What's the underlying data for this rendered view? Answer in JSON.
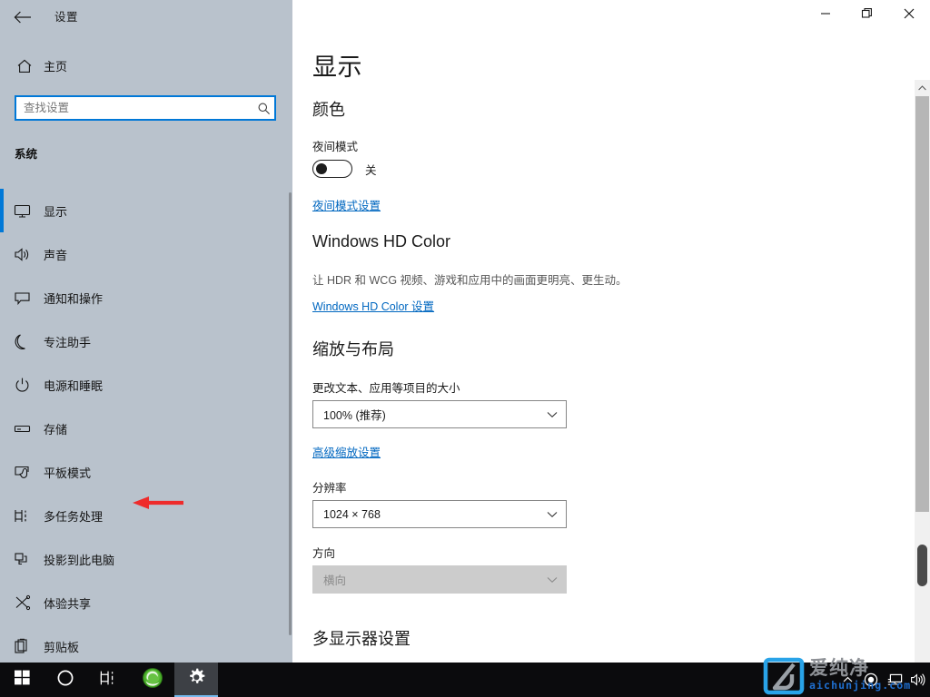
{
  "window": {
    "app_title": "设置",
    "back_icon": "back-arrow-icon",
    "minimize_label": "—",
    "maximize_label": "❐",
    "close_label": "✕"
  },
  "sidebar": {
    "home": {
      "label": "主页",
      "icon": "home-icon"
    },
    "search": {
      "placeholder": "查找设置",
      "value": "",
      "icon": "search-icon"
    },
    "group_title": "系统",
    "items": [
      {
        "label": "显示",
        "icon": "monitor-icon",
        "active": true
      },
      {
        "label": "声音",
        "icon": "speaker-icon",
        "active": false
      },
      {
        "label": "通知和操作",
        "icon": "notification-icon",
        "active": false
      },
      {
        "label": "专注助手",
        "icon": "moon-icon",
        "active": false
      },
      {
        "label": "电源和睡眠",
        "icon": "power-icon",
        "active": false
      },
      {
        "label": "存储",
        "icon": "storage-icon",
        "active": false
      },
      {
        "label": "平板模式",
        "icon": "tablet-mode-icon",
        "active": false
      },
      {
        "label": "多任务处理",
        "icon": "multitasking-icon",
        "active": false
      },
      {
        "label": "投影到此电脑",
        "icon": "project-to-pc-icon",
        "active": false
      },
      {
        "label": "体验共享",
        "icon": "shared-experiences-icon",
        "active": false
      },
      {
        "label": "剪贴板",
        "icon": "clipboard-icon",
        "active": false
      }
    ]
  },
  "main": {
    "page_title": "显示",
    "color_section": {
      "heading": "颜色",
      "night_light_label": "夜间模式",
      "night_light_state": "关",
      "night_light_on": false,
      "night_light_settings_link": "夜间模式设置"
    },
    "hdr_section": {
      "heading": "Windows HD Color",
      "description": "让 HDR 和 WCG 视频、游戏和应用中的画面更明亮、更生动。",
      "link": "Windows HD Color 设置"
    },
    "scale_section": {
      "heading": "缩放与布局",
      "scale_label": "更改文本、应用等项目的大小",
      "scale_value": "100% (推荐)",
      "advanced_link": "高级缩放设置",
      "resolution_label": "分辨率",
      "resolution_value": "1024 × 768",
      "orientation_label": "方向",
      "orientation_value": "横向",
      "orientation_disabled": true
    },
    "multi_display_heading": "多显示器设置"
  },
  "annotation": {
    "arrow": "red-left-arrow",
    "color": "#ee2b2b"
  },
  "taskbar": {
    "items": [
      {
        "name": "start-button",
        "icon": "windows-logo-icon"
      },
      {
        "name": "cortana-search-button",
        "icon": "circle-search-icon"
      },
      {
        "name": "task-view-button",
        "icon": "task-view-icon"
      },
      {
        "name": "browser-button",
        "icon": "ie-globe-icon"
      },
      {
        "name": "settings-button",
        "icon": "gear-icon",
        "active": true
      }
    ],
    "tray": [
      {
        "name": "show-hidden-icons",
        "icon": "chevron-up-icon"
      },
      {
        "name": "recording-indicator",
        "icon": "record-dot-icon"
      },
      {
        "name": "network-icon",
        "icon": "monitor-network-icon"
      },
      {
        "name": "volume-icon",
        "icon": "speaker-icon"
      }
    ]
  },
  "watermark": {
    "cn_text": "爱纯净",
    "en_text": "aichunjing.com",
    "logo_color": "#29a3e8",
    "cn_color": "#8e9196",
    "en_color": "#1f6fd0"
  },
  "colors": {
    "accent": "#0078d7",
    "sidebar_bg": "#b9c2cc",
    "link": "#0067c0",
    "taskbar_bg": "#0b0b0d"
  }
}
